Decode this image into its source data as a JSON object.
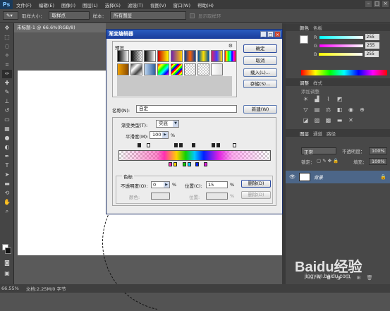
{
  "app": {
    "logo": "Ps"
  },
  "menubar": {
    "items": [
      "文件(F)",
      "编辑(E)",
      "图像(I)",
      "图层(L)",
      "选择(S)",
      "滤镜(T)",
      "视图(V)",
      "窗口(W)",
      "帮助(H)"
    ]
  },
  "options": {
    "sample_size_label": "取样大小：",
    "sample_size_value": "取样点",
    "sample_label": "样本：",
    "sample_value": "所有图层",
    "show_ring_label": "显示取样环"
  },
  "document": {
    "tab_title": "未标题-1 @ 66.6%(RGB/8)"
  },
  "status": {
    "zoom": "66.55%",
    "doc_info": "文档:2.25M/0 字节"
  },
  "panels": {
    "color_tabs": [
      "颜色",
      "色板"
    ],
    "color_sliders": [
      {
        "label": "R",
        "value": "255"
      },
      {
        "label": "G",
        "value": "255"
      },
      {
        "label": "B",
        "value": "255"
      }
    ],
    "adjust_tabs": [
      "调整",
      "样式"
    ],
    "adjust_title": "添加调整",
    "layers_tabs": [
      "图层",
      "通道",
      "路径"
    ],
    "blend_mode": "正常",
    "opacity_label": "不透明度：",
    "opacity_value": "100%",
    "lock_label": "锁定：",
    "fill_label": "填充：",
    "fill_value": "100%",
    "layer_name": "背景"
  },
  "dialog": {
    "title": "渐变编辑器",
    "presets_label": "预设",
    "ok": "确定",
    "cancel": "取消",
    "load": "载入(L)...",
    "save": "存储(S)...",
    "name_label": "名称(N):",
    "name_value": "自定",
    "new_button": "新建(W)",
    "gradient_type_label": "渐变类型(T):",
    "gradient_type_value": "实底",
    "smoothness_label": "平滑度(M):",
    "smoothness_value": "100",
    "smoothness_unit": "%",
    "stops_group_label": "色标",
    "opacity_label": "不透明度(O):",
    "opacity_value": "0",
    "opacity_unit": "%",
    "location_label": "位置(C):",
    "location_value": "15",
    "location_unit": "%",
    "delete_label": "删除(D)",
    "color_label": "颜色:",
    "color_location_label": "位置:",
    "color_unit": "%",
    "color_delete_label": "删除(D)"
  },
  "watermark": {
    "brand": "Baidu经验",
    "url": "jingyan.baidu.com"
  },
  "colors": {
    "accent_selected_layer": "#4c6688",
    "dialog_title": "#2a5cc0"
  }
}
